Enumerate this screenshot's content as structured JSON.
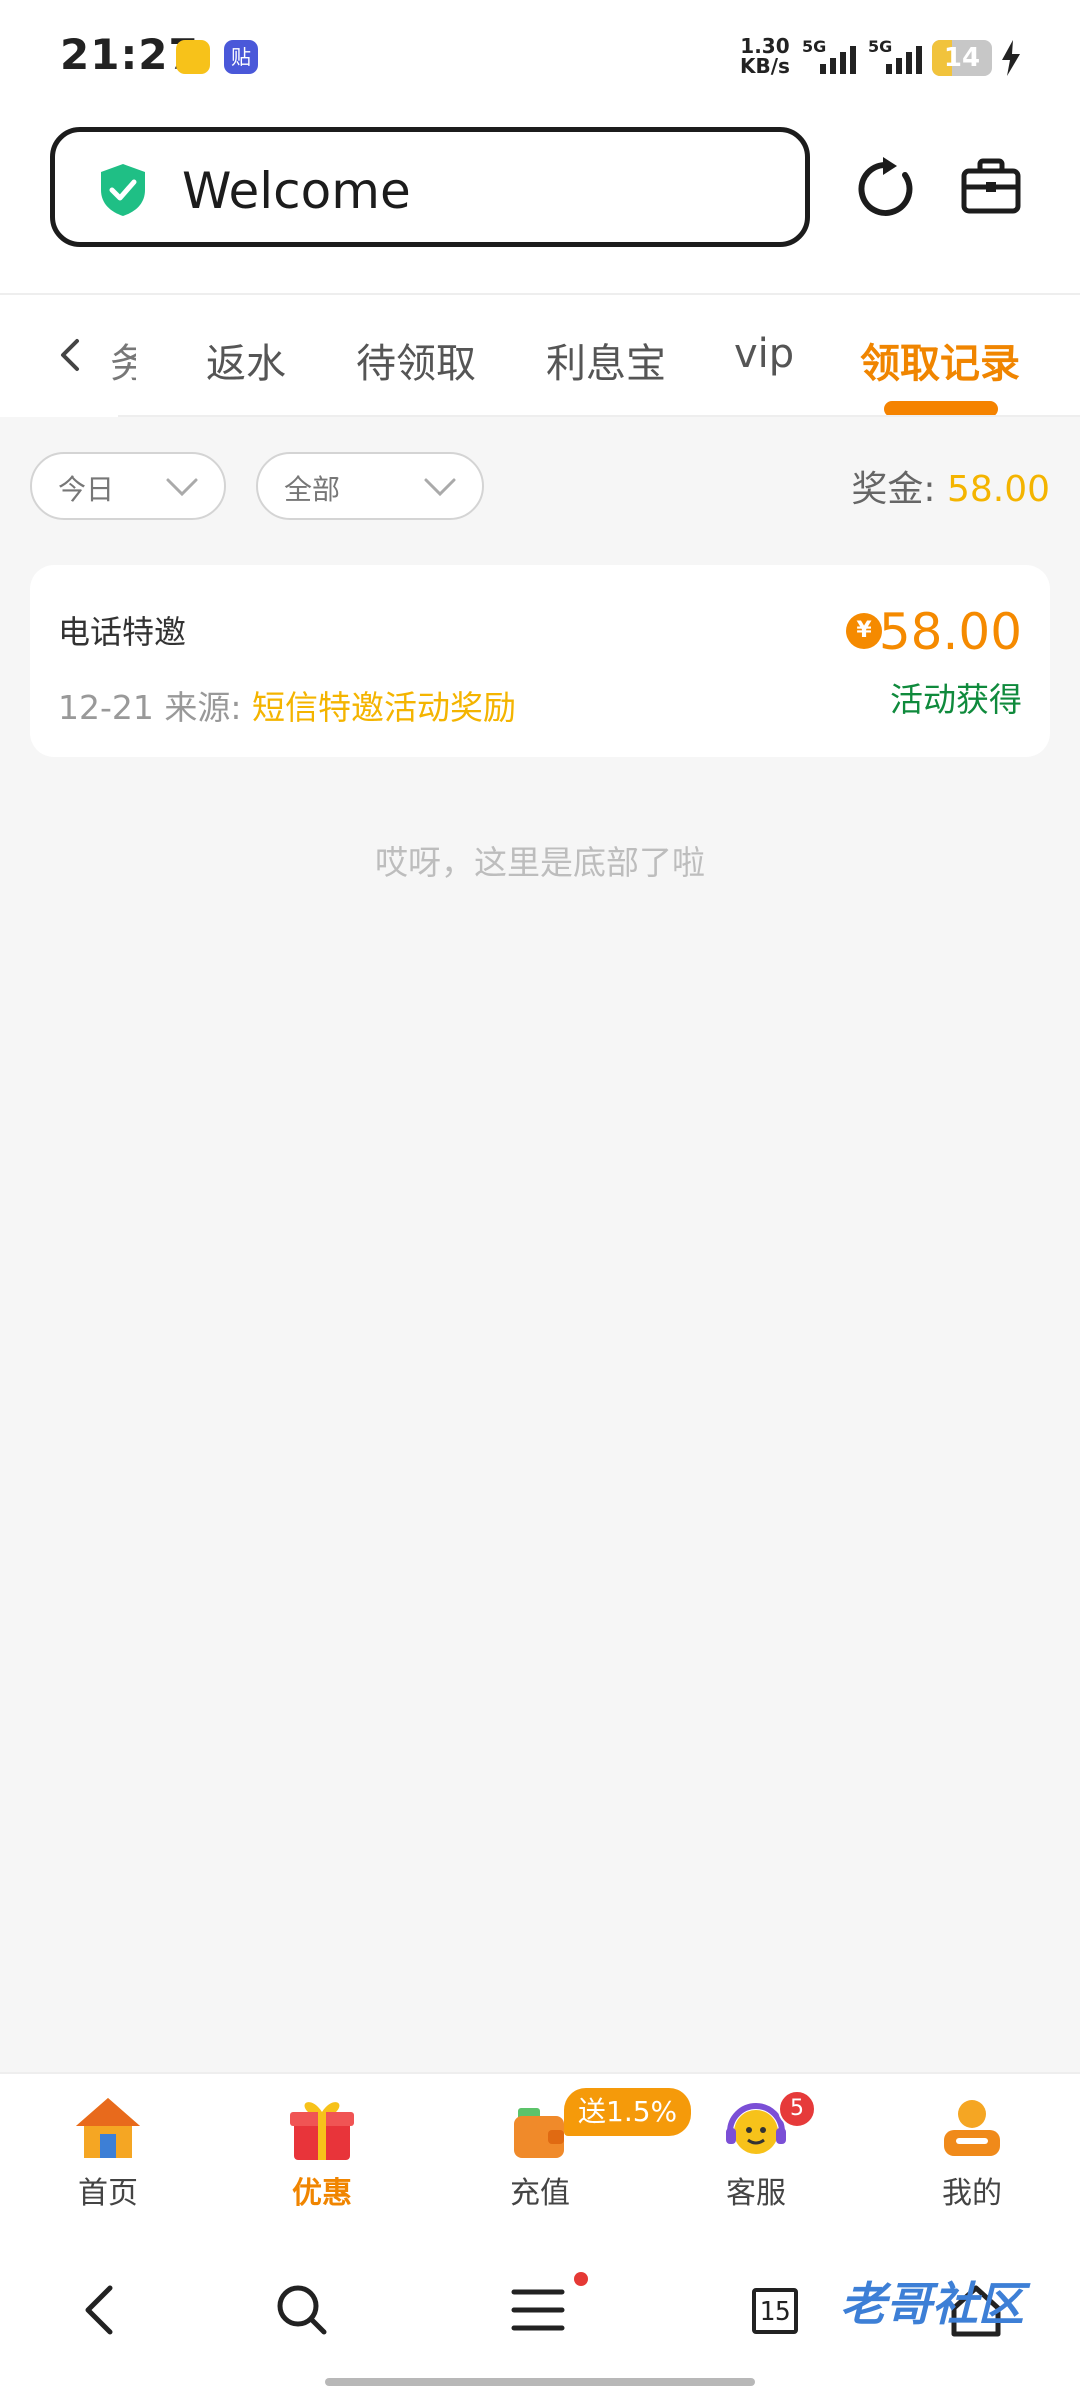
{
  "status_bar": {
    "time": "21:27",
    "net_speed": "1.30",
    "net_unit": "KB/s",
    "sig1": "5G",
    "sig2": "5G",
    "battery": "14",
    "app_icon_b": "贴"
  },
  "header": {
    "welcome": "Welcome",
    "icons": [
      "shield-check-icon",
      "refresh-icon",
      "briefcase-icon"
    ]
  },
  "tabs": {
    "partial": "务",
    "items": [
      "返水",
      "待领取",
      "利息宝",
      "vip",
      "领取记录"
    ],
    "active_index": 4
  },
  "filters": {
    "date": "今日",
    "type": "全部"
  },
  "bonus": {
    "label": "奖金:",
    "value": "58.00"
  },
  "record": {
    "title": "电话特邀",
    "date": "12-21",
    "source_label": "来源:",
    "source": "短信特邀活动奖励",
    "currency_symbol": "¥",
    "amount": "58.00",
    "status": "活动获得"
  },
  "bottom_note": "哎呀，这里是底部了啦",
  "bottom_nav": {
    "items": [
      "首页",
      "优惠",
      "充值",
      "客服",
      "我的"
    ],
    "active_index": 1,
    "promo": "送1.5%",
    "badge": "5"
  },
  "system_nav": {
    "tab_count": "15",
    "watermark": "老哥社区"
  },
  "colors": {
    "accent": "#f58300",
    "gold": "#f4b400",
    "green": "#0f8a3c"
  }
}
